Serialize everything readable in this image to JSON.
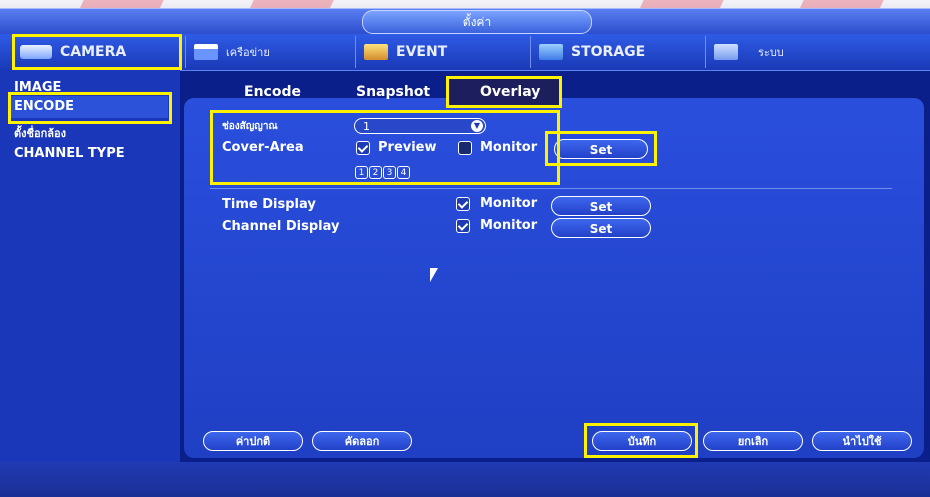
{
  "window": {
    "title": "ตั้งค่า"
  },
  "nav": {
    "tabs": [
      {
        "label": "CAMERA",
        "icon": "camera-icon"
      },
      {
        "label": "เครือข่าย",
        "icon": "network-icon"
      },
      {
        "label": "EVENT",
        "icon": "event-icon"
      },
      {
        "label": "STORAGE",
        "icon": "storage-icon"
      },
      {
        "label": "ระบบ",
        "icon": "system-icon"
      }
    ]
  },
  "sidebar": {
    "items": [
      {
        "label": "IMAGE"
      },
      {
        "label": "ENCODE",
        "selected": true
      },
      {
        "label": "ตั้งชื่อกล้อง"
      },
      {
        "label": "CHANNEL TYPE"
      }
    ]
  },
  "subtabs": [
    {
      "label": "Encode"
    },
    {
      "label": "Snapshot"
    },
    {
      "label": "Overlay",
      "active": true
    }
  ],
  "overlay": {
    "channel_label": "ช่องสัญญาณ",
    "channel_value": "1",
    "cover_area_label": "Cover-Area",
    "preview_label": "Preview",
    "preview_checked": true,
    "monitor_label": "Monitor",
    "monitor_checked": false,
    "set_label": "Set",
    "regions": [
      "1",
      "2",
      "3",
      "4"
    ],
    "time_display_label": "Time Display",
    "channel_display_label": "Channel Display"
  },
  "footer": {
    "default_label": "ค่าปกติ",
    "copy_label": "คัดลอก",
    "save_label": "บันทึก",
    "cancel_label": "ยกเลิก",
    "apply_label": "นำไปใช้"
  },
  "colors": {
    "highlight": "#fff200",
    "background": "#0a1f8a",
    "panel": "#2a4fdd"
  }
}
